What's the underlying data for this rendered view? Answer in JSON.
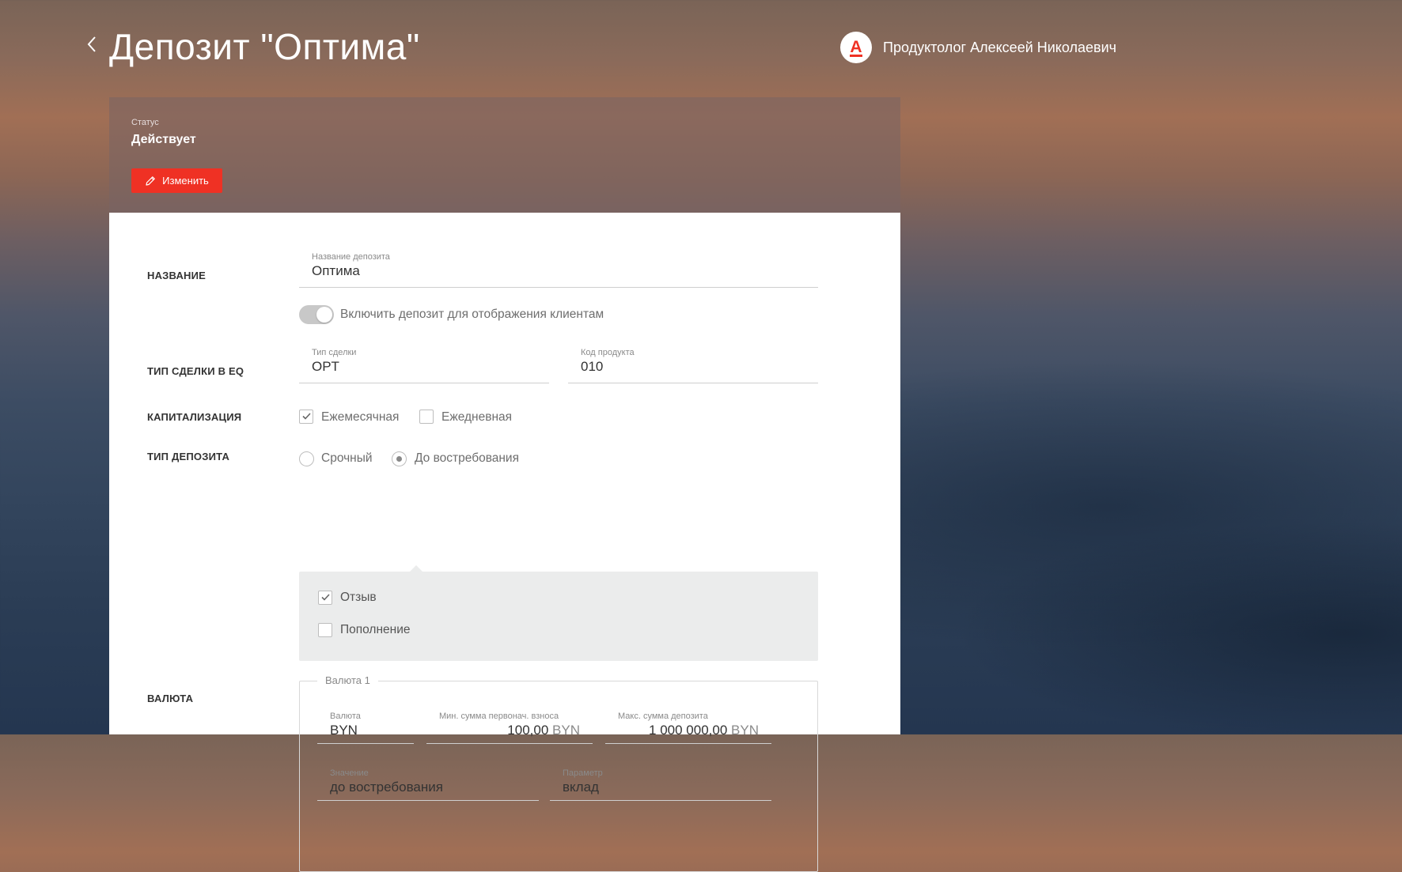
{
  "header": {
    "title": "Депозит \"Оптима\"",
    "user_name": "Продуктолог Алексеей Николаевич",
    "avatar_letter": "А"
  },
  "status": {
    "label": "Статус",
    "value": "Действует",
    "edit_label": "Изменить"
  },
  "form": {
    "name_row": {
      "label": "НАЗВАНИЕ",
      "field_label": "Название депозита",
      "field_value": "Оптима",
      "toggle_label": "Включить депозит для отображения клиентам",
      "toggle_on": true
    },
    "deal_row": {
      "label": "ТИП СДЕЛКИ В EQ",
      "deal_type_label": "Тип сделки",
      "deal_type_value": "OPT",
      "product_code_label": "Код продукта",
      "product_code_value": "010"
    },
    "capitalization_row": {
      "label": "КАПИТАЛИЗАЦИЯ",
      "options": [
        {
          "label": "Ежемесячная",
          "checked": true
        },
        {
          "label": "Ежедневная",
          "checked": false
        }
      ]
    },
    "deposit_type_row": {
      "label": "ТИП ДЕПОЗИТА",
      "options": [
        {
          "label": "Срочный",
          "selected": false
        },
        {
          "label": "До востребования",
          "selected": true
        }
      ],
      "sub_options": [
        {
          "label": "Отзыв",
          "checked": true
        },
        {
          "label": "Пополнение",
          "checked": false
        }
      ]
    },
    "currency_row": {
      "label": "ВАЛЮТА",
      "legend": "Валюта 1",
      "currency_label": "Валюта",
      "currency_value": "BYN",
      "min_label": "Мин. сумма первонач. взноса",
      "min_value": "100,00",
      "min_unit": "BYN",
      "max_label": "Макс. сумма депозита",
      "max_value": "1 000 000,00",
      "max_unit": "BYN",
      "value_label": "Значение",
      "value_value": "до востребования",
      "param_label": "Параметр",
      "param_value": "вклад"
    }
  },
  "colors": {
    "accent": "#ef3124",
    "text": "#333333",
    "muted": "#8a8a8a"
  }
}
